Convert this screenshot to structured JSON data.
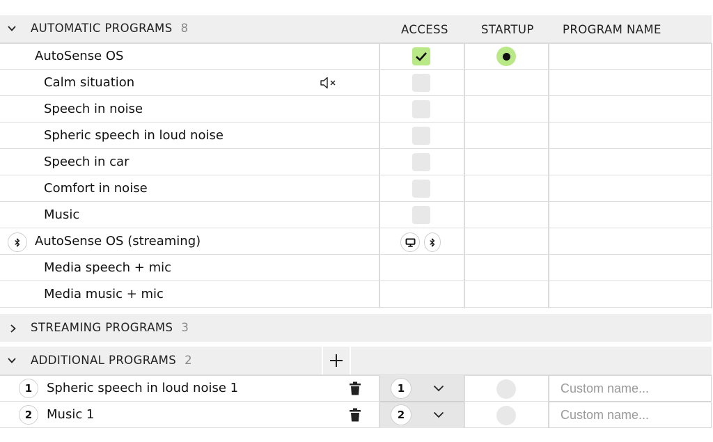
{
  "automatic": {
    "title": "AUTOMATIC PROGRAMS",
    "count": "8",
    "columns": {
      "access": "ACCESS",
      "startup": "STARTUP",
      "program_name": "PROGRAM NAME"
    },
    "rows": [
      {
        "label": "AutoSense OS"
      },
      {
        "label": "Calm situation"
      },
      {
        "label": "Speech in noise"
      },
      {
        "label": "Spheric speech in loud noise"
      },
      {
        "label": "Speech in car"
      },
      {
        "label": "Comfort in noise"
      },
      {
        "label": "Music"
      },
      {
        "label": "AutoSense OS (streaming)"
      },
      {
        "label": "Media speech + mic"
      },
      {
        "label": "Media music + mic"
      }
    ]
  },
  "streaming": {
    "title": "STREAMING PROGRAMS",
    "count": "3"
  },
  "additional": {
    "title": "ADDITIONAL PROGRAMS",
    "count": "2",
    "rows": [
      {
        "index": "1",
        "label": "Spheric speech in loud noise 1",
        "selected": "1",
        "placeholder": "Custom name..."
      },
      {
        "index": "2",
        "label": "Music 1",
        "selected": "2",
        "placeholder": "Custom name..."
      }
    ]
  },
  "icons": {
    "expanded": "chevron-down-icon",
    "collapsed": "chevron-right-icon",
    "mute": "speaker-mute-icon",
    "bluetooth": "bluetooth-icon",
    "tv": "tv-icon",
    "add": "plus-icon",
    "delete": "trash-icon",
    "check": "check-icon"
  },
  "colors": {
    "accent": "#b9e887",
    "header_bg": "#efefef",
    "divider": "#dcdcdc"
  }
}
